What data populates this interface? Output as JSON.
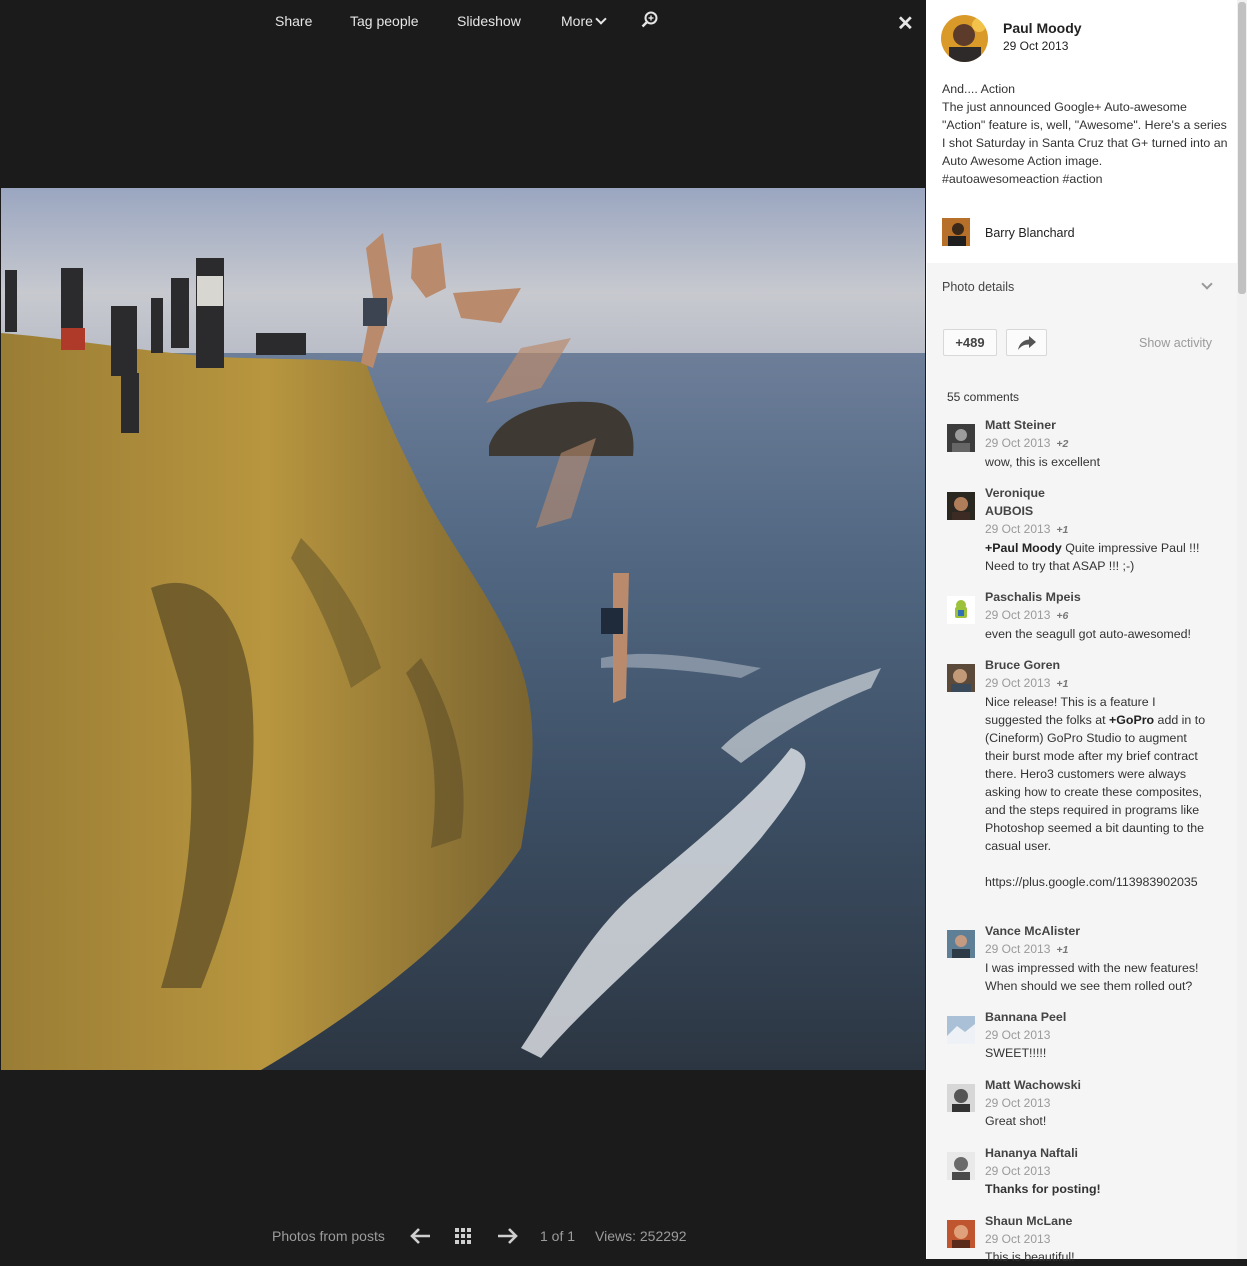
{
  "toolbar": {
    "share": "Share",
    "tag_people": "Tag people",
    "slideshow": "Slideshow",
    "more": "More"
  },
  "footer": {
    "photos_from_posts": "Photos from posts",
    "position": "1 of 1",
    "views": "Views: 252292"
  },
  "post": {
    "author": "Paul Moody",
    "date": "29 Oct 2013",
    "lines": [
      "And.... Action",
      "The just announced Google+ Auto-awesome",
      "\"Action\" feature is, well, \"Awesome\". Here's a series",
      "I shot Saturday in Santa Cruz that G+ turned into an",
      "Auto Awesome Action image.",
      "#autoawesomeaction  #action"
    ],
    "tagged_person": "Barry Blanchard",
    "photo_details": "Photo details",
    "plus_count": "+489",
    "show_activity": "Show activity",
    "comments_count": "55 comments"
  },
  "comments": [
    {
      "name": "Matt Steiner",
      "date": "29 Oct 2013",
      "plus": "+2",
      "text": "wow, this is excellent"
    },
    {
      "name": "Veronique\nAUBOIS",
      "date": "29 Oct 2013",
      "plus": "+1",
      "mention": "+Paul Moody",
      "text": "  Quite impressive Paul !!!\nNeed to try that ASAP !!!  ;-)"
    },
    {
      "name": "Paschalis Mpeis",
      "date": "29 Oct 2013",
      "plus": "+6",
      "text": "even the seagull got auto-awesomed!"
    },
    {
      "name": "Bruce Goren",
      "date": "29 Oct 2013",
      "plus": "+1",
      "text_before": "Nice release! This is a feature I\nsuggested  the folks at ",
      "mention": "+GoPro",
      "text_after": " add in to\n(Cineform) GoPro Studio to augment\ntheir burst mode after my brief contract\nthere. Hero3 customers were always\nasking how to create these composites,\nand the steps required in programs like\nPhotoshop seemed a bit daunting to the\ncasual user.",
      "link": "https://plus.google.com/113983902035"
    },
    {
      "name": "Vance McAlister",
      "date": "29 Oct 2013",
      "plus": "+1",
      "text": "I was impressed with the new features!\n When should we see them rolled out?"
    },
    {
      "name": "Bannana Peel",
      "date": "29 Oct 2013",
      "text": "SWEET!!!!!"
    },
    {
      "name": "Matt Wachowski",
      "date": "29 Oct 2013",
      "text": "Great shot!"
    },
    {
      "name": "Hananya Naftali",
      "date": "29 Oct 2013",
      "text": "Thanks for posting!"
    },
    {
      "name": "Shaun McLane",
      "date": "29 Oct 2013",
      "text": "This is beautiful!"
    }
  ],
  "icons": {
    "search": "search-zoom-icon",
    "close": "close-icon",
    "prev": "arrow-left-icon",
    "grid": "grid-icon",
    "next": "arrow-right-icon",
    "share": "share-arrow-icon",
    "details": "chevron-down-icon"
  }
}
